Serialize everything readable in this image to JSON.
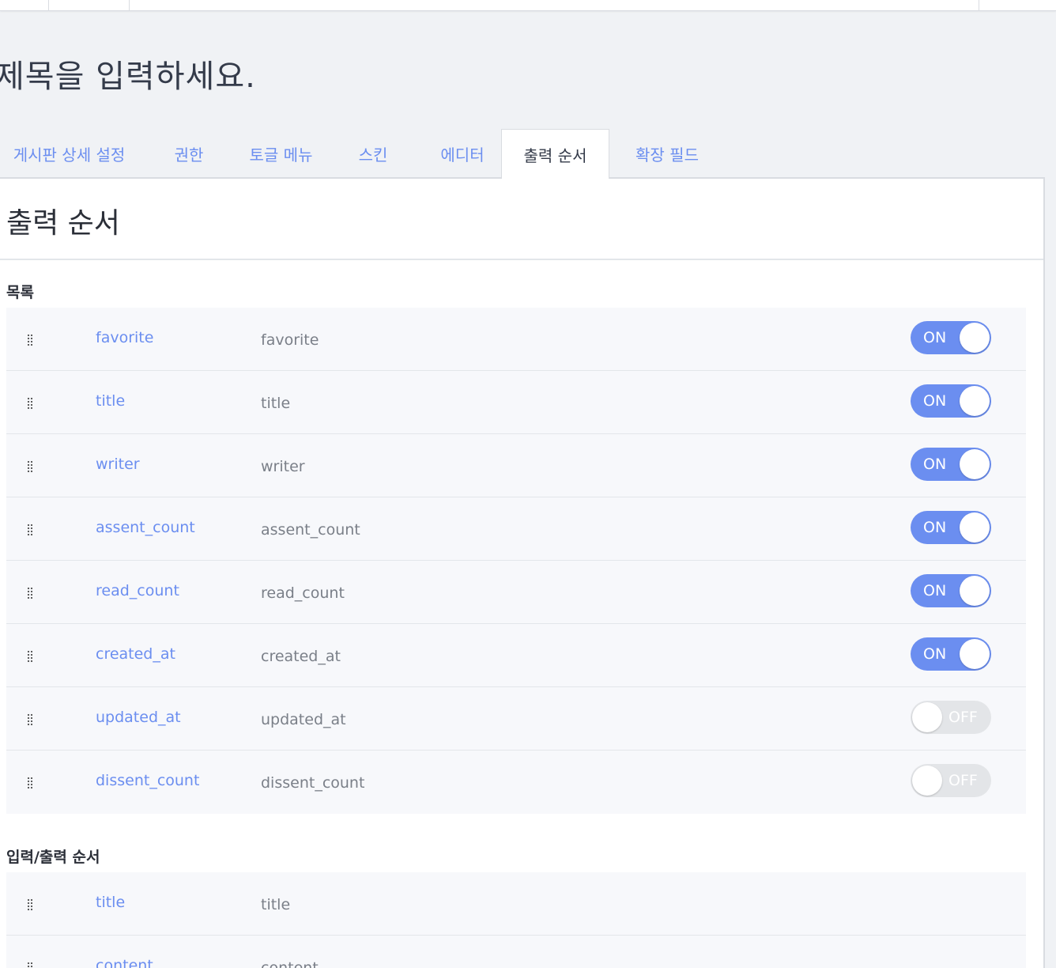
{
  "page": {
    "title": "제목을 입력하세요."
  },
  "tabs": [
    {
      "label": "게시판 상세 설정"
    },
    {
      "label": "권한"
    },
    {
      "label": "토글 메뉴"
    },
    {
      "label": "스킨"
    },
    {
      "label": "에디터"
    },
    {
      "label": "출력 순서",
      "active": true
    },
    {
      "label": "확장 필드"
    }
  ],
  "panel": {
    "title": "출력 순서"
  },
  "list_section": {
    "title": "목록",
    "rows": [
      {
        "name": "favorite",
        "label": "favorite",
        "toggle": "ON"
      },
      {
        "name": "title",
        "label": "title",
        "toggle": "ON"
      },
      {
        "name": "writer",
        "label": "writer",
        "toggle": "ON"
      },
      {
        "name": "assent_count",
        "label": "assent_count",
        "toggle": "ON"
      },
      {
        "name": "read_count",
        "label": "read_count",
        "toggle": "ON"
      },
      {
        "name": "created_at",
        "label": "created_at",
        "toggle": "ON"
      },
      {
        "name": "updated_at",
        "label": "updated_at",
        "toggle": "OFF"
      },
      {
        "name": "dissent_count",
        "label": "dissent_count",
        "toggle": "OFF"
      }
    ]
  },
  "io_section": {
    "title": "입력/출력 순서",
    "rows": [
      {
        "name": "title",
        "label": "title"
      },
      {
        "name": "content",
        "label": "content"
      }
    ]
  },
  "colors": {
    "accent": "#6b8ef0",
    "toggle_off": "#e3e5e8",
    "text_dark": "#343b4a"
  },
  "icons": {
    "drag_handle": "drag-handle-icon"
  }
}
